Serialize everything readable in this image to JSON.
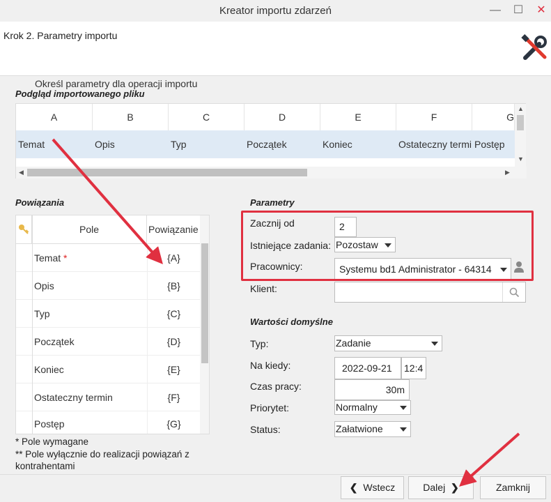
{
  "window": {
    "title": "Kreator importu zdarzeń",
    "minimize": "—",
    "maximize": "☐",
    "close": "✕"
  },
  "header": {
    "step_title": "Krok 2. Parametry importu"
  },
  "intro": "Określ parametry dla operacji importu",
  "preview": {
    "section_title": "Podgląd importowanego pliku",
    "columns": [
      "A",
      "B",
      "C",
      "D",
      "E",
      "F",
      "G"
    ],
    "row": [
      "Temat",
      "Opis",
      "Typ",
      "Początek",
      "Koniec",
      "Ostateczny termin",
      "Postęp"
    ]
  },
  "bindings": {
    "section_title": "Powiązania",
    "col_field": "Pole",
    "col_binding": "Powiązanie",
    "rows": [
      {
        "field": "Temat",
        "required": "*",
        "binding": "{A}"
      },
      {
        "field": "Opis",
        "required": "",
        "binding": "{B}"
      },
      {
        "field": "Typ",
        "required": "",
        "binding": "{C}"
      },
      {
        "field": "Początek",
        "required": "",
        "binding": "{D}"
      },
      {
        "field": "Koniec",
        "required": "",
        "binding": "{E}"
      },
      {
        "field": "Ostateczny termin",
        "required": "",
        "binding": "{F}"
      },
      {
        "field": "Postęp",
        "required": "",
        "binding": "{G}"
      }
    ],
    "note_required": "* Pole wymagane",
    "note_contractors": "** Pole wyłącznie do realizacji powiązań z kontrahentami"
  },
  "params": {
    "section_title": "Parametry",
    "start_label": "Zacznij od",
    "start_value": "2",
    "existing_label": "Istniejące zadania:",
    "existing_value": "Pozostaw",
    "workers_label": "Pracownicy:",
    "workers_value": "Systemu bd1 Administrator - 64314",
    "client_label": "Klient:",
    "client_value": ""
  },
  "defaults": {
    "section_title": "Wartości domyślne",
    "type_label": "Typ:",
    "type_value": "Zadanie",
    "due_label": "Na kiedy:",
    "due_date": "2022-09-21",
    "due_time": "12:4",
    "work_label": "Czas pracy:",
    "work_value": "30m",
    "priority_label": "Priorytet:",
    "priority_value": "Normalny",
    "status_label": "Status:",
    "status_value": "Załatwione"
  },
  "footer": {
    "back": "Wstecz",
    "next": "Dalej",
    "close": "Zamknij"
  },
  "colors": {
    "highlight_row": "#dfeaf5",
    "annotation_red": "#e03040",
    "required_star": "#dd2222"
  }
}
